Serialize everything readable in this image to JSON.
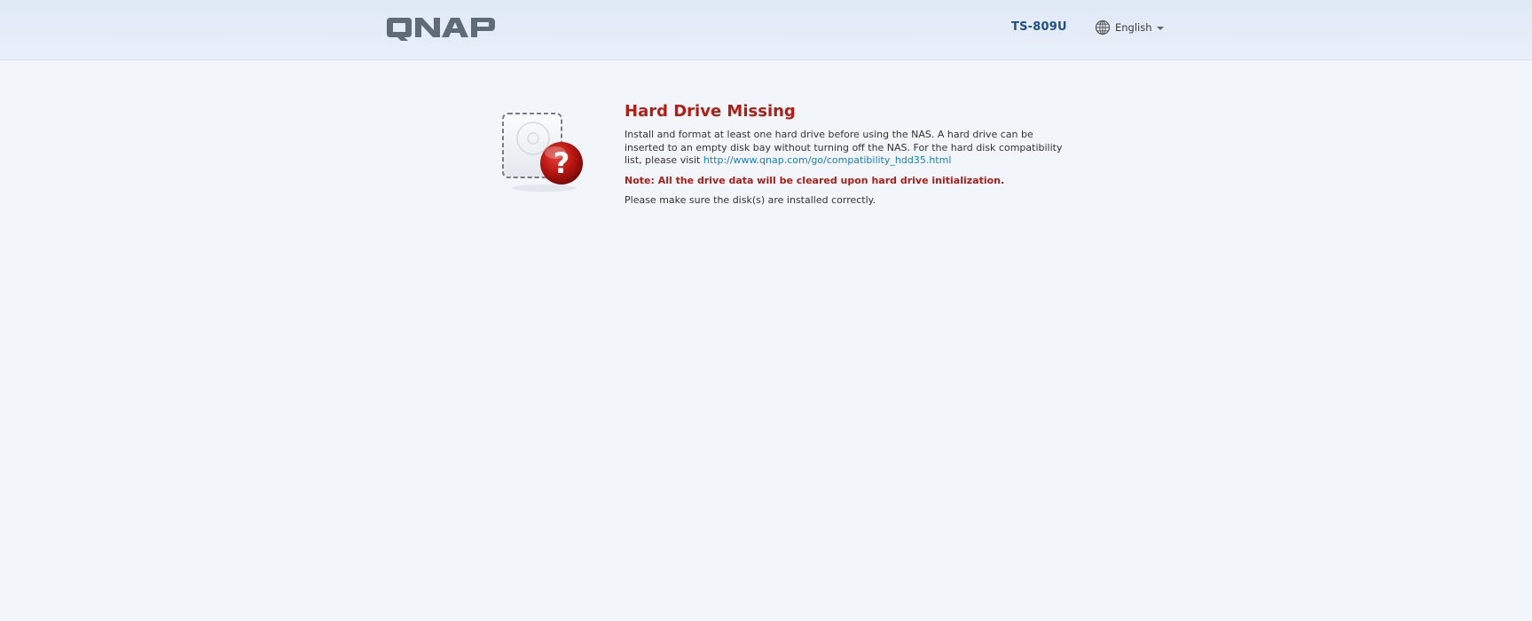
{
  "header": {
    "logo_text": "QNAP",
    "model": "TS-809U",
    "language": {
      "label": "English",
      "icon": "globe-icon"
    }
  },
  "main": {
    "icon": "hard-drive-question-icon",
    "title": "Hard Drive Missing",
    "description": "Install and format at least one hard drive before using the NAS. A hard drive can be inserted to an empty disk bay without turning off the NAS. For the hard disk compatibility list, please visit ",
    "link_text": "http://www.qnap.com/go/compatibility_hdd35.html",
    "note": "Note: All the drive data will be cleared upon hard drive initialization.",
    "install_message": "Please make sure the disk(s) are installed correctly."
  },
  "colors": {
    "header_bg": "#e3ecf7",
    "page_bg": "#f2f5fa",
    "title_red": "#b41d16",
    "model_blue": "#1f4e8c",
    "link_blue": "#1a7fc7",
    "logo_gray": "#5f6b77"
  }
}
